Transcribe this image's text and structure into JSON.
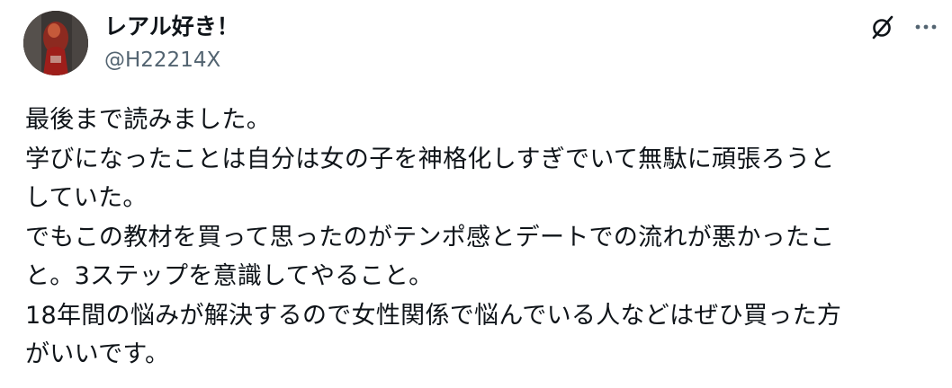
{
  "post": {
    "author": {
      "display_name": "レアル好き！",
      "handle": "@H22214X",
      "avatar_icon": "avatar-photo"
    },
    "actions": {
      "grok_icon": "grok-icon",
      "more_icon": "more-icon"
    },
    "body_lines": [
      "最後まで読みました。",
      "学びになったことは自分は女の子を神格化しすぎでいて無駄に頑張ろうと",
      "していた。",
      "でもこの教材を買って思ったのがテンポ感とデートでの流れが悪かったこ",
      "と。3ステップを意識してやること。",
      "18年間の悩みが解決するので女性関係で悩んでいる人などはぜひ買った方",
      "がいいです。"
    ]
  },
  "colors": {
    "text": "#0f1419",
    "secondary": "#536471",
    "background": "#ffffff"
  }
}
